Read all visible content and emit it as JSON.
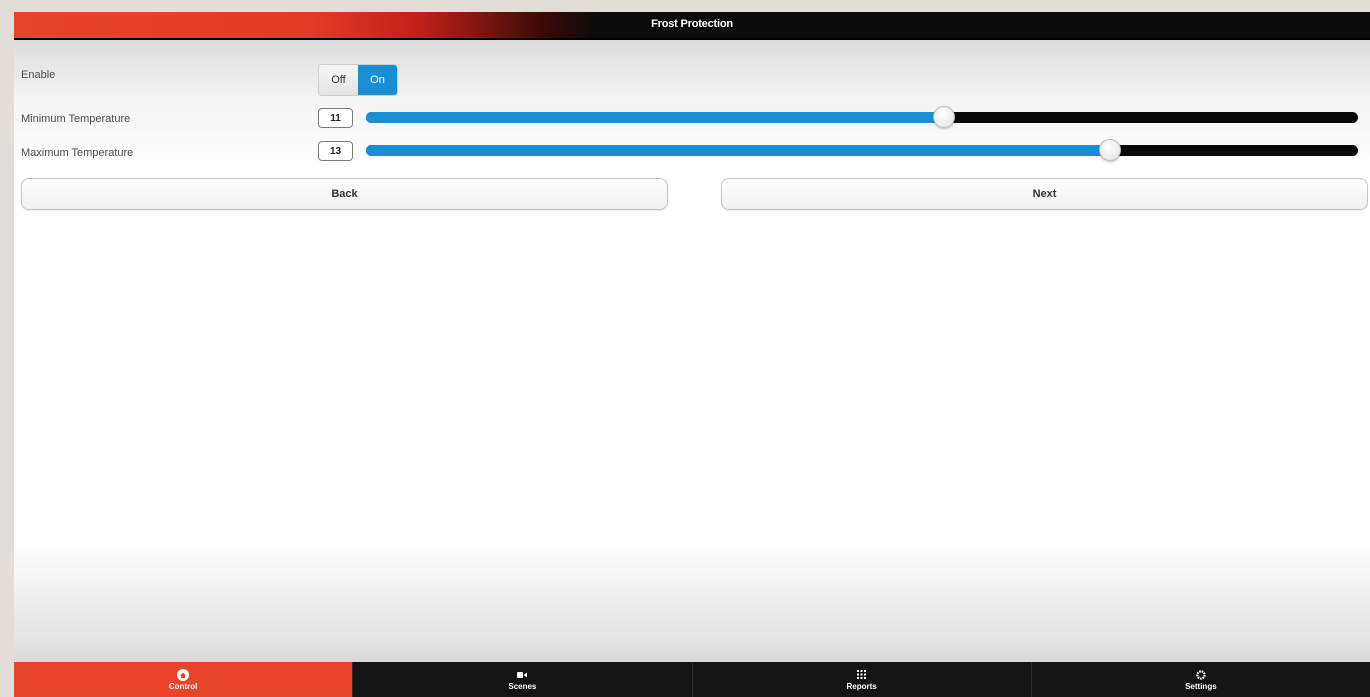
{
  "header": {
    "title": "Frost Protection"
  },
  "enable": {
    "label": "Enable",
    "off_label": "Off",
    "on_label": "On",
    "selected": "On"
  },
  "min_temp": {
    "label": "Minimum Temperature",
    "value": "11",
    "fill_fraction": 0.583
  },
  "max_temp": {
    "label": "Maximum Temperature",
    "value": "13",
    "fill_fraction": 0.75
  },
  "buttons": {
    "back": "Back",
    "next": "Next"
  },
  "nav": {
    "items": [
      {
        "label": "Control",
        "icon": "home-icon",
        "active": true
      },
      {
        "label": "Scenes",
        "icon": "camera-icon",
        "active": false
      },
      {
        "label": "Reports",
        "icon": "grid-icon",
        "active": false
      },
      {
        "label": "Settings",
        "icon": "gear-icon",
        "active": false
      }
    ]
  },
  "colors": {
    "accent": "#1a8ed2",
    "brand": "#e8442a",
    "bar": "#141414"
  }
}
